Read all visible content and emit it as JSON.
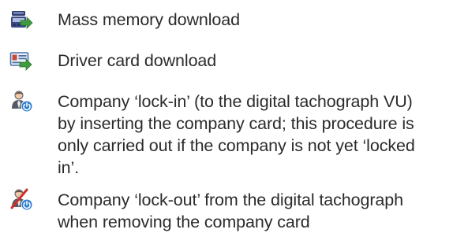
{
  "legend": {
    "items": [
      {
        "icon": "mass-memory-download-icon",
        "lines": [
          "Mass memory download"
        ]
      },
      {
        "icon": "driver-card-download-icon",
        "lines": [
          "Driver card download"
        ]
      },
      {
        "icon": "company-lock-in-icon",
        "lines": [
          "Company ‘lock-in’ (to the digital tachograph VU)",
          "by inserting the company card; this procedure is",
          "only carried out if the company is not yet ‘locked",
          "in’."
        ]
      },
      {
        "icon": "company-lock-out-icon",
        "lines": [
          "Company ‘lock-out’ from the digital tachograph",
          "when removing the company card"
        ]
      }
    ],
    "colors": {
      "text": "#2b2b2b",
      "arrow_green": "#3f9a3f",
      "device_navy": "#2f3c6e",
      "card_blue": "#4a6fa8",
      "person_gray": "#555a66",
      "power_blue": "#2f7fd0",
      "cross_red": "#d0302a"
    }
  }
}
